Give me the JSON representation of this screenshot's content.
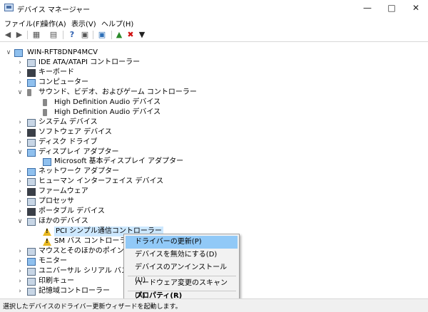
{
  "window": {
    "title": "デバイス マネージャー"
  },
  "menu": [
    "ファイル(F)",
    "操作(A)",
    "表示(V)",
    "ヘルプ(H)"
  ],
  "tree": {
    "root": "WIN-RFT8DNP4MCV",
    "items": [
      {
        "label": "IDE ATA/ATAPI コントローラー",
        "icon": "ide-controller-icon",
        "expanded": false
      },
      {
        "label": "キーボード",
        "icon": "keyboard-icon",
        "expanded": false
      },
      {
        "label": "コンピューター",
        "icon": "computer-icon",
        "expanded": false
      },
      {
        "label": "サウンド、ビデオ、およびゲーム コントローラー",
        "icon": "speaker-icon",
        "expanded": true
      },
      {
        "label": "High Definition Audio デバイス",
        "icon": "speaker-icon",
        "child": true
      },
      {
        "label": "High Definition Audio デバイス",
        "icon": "speaker-icon",
        "child": true
      },
      {
        "label": "システム デバイス",
        "icon": "system-device-icon",
        "expanded": false
      },
      {
        "label": "ソフトウェア デバイス",
        "icon": "software-device-icon",
        "expanded": false
      },
      {
        "label": "ディスク ドライブ",
        "icon": "disk-drive-icon",
        "expanded": false
      },
      {
        "label": "ディスプレイ アダプター",
        "icon": "display-adapter-icon",
        "expanded": true
      },
      {
        "label": "Microsoft 基本ディスプレイ アダプター",
        "icon": "display-adapter-icon",
        "child": true
      },
      {
        "label": "ネットワーク アダプター",
        "icon": "network-adapter-icon",
        "expanded": false
      },
      {
        "label": "ヒューマン インターフェイス デバイス",
        "icon": "hid-icon",
        "expanded": false
      },
      {
        "label": "ファームウェア",
        "icon": "firmware-icon",
        "expanded": false
      },
      {
        "label": "プロセッサ",
        "icon": "processor-icon",
        "expanded": false
      },
      {
        "label": "ポータブル デバイス",
        "icon": "portable-device-icon",
        "expanded": false
      },
      {
        "label": "ほかのデバイス",
        "icon": "other-device-icon",
        "expanded": true
      },
      {
        "label": "PCI シンプル通信コントローラー",
        "icon": "warning-device-icon",
        "child": true,
        "selected": true
      },
      {
        "label": "SM バス コントローラー",
        "icon": "warning-device-icon",
        "child": true
      },
      {
        "label": "マウスとそのほかのポインティング",
        "icon": "mouse-icon",
        "expanded": false
      },
      {
        "label": "モニター",
        "icon": "monitor-icon",
        "expanded": false
      },
      {
        "label": "ユニバーサル シリアル バス コ",
        "icon": "usb-icon",
        "expanded": false
      },
      {
        "label": "印刷キュー",
        "icon": "printer-icon",
        "expanded": false
      },
      {
        "label": "記憶域コントローラー",
        "icon": "storage-controller-icon",
        "expanded": false
      }
    ]
  },
  "context_menu": {
    "update_driver": "ドライバーの更新(P)",
    "disable": "デバイスを無効にする(D)",
    "uninstall": "デバイスのアンインストール(U)",
    "scan": "ハードウェア変更のスキャン(A)",
    "properties": "プロパティ(R)"
  },
  "status": "選択したデバイスのドライバー更新ウィザードを起動します。"
}
